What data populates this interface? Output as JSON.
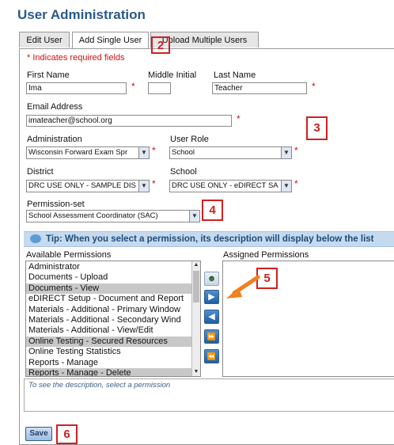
{
  "page_title": "User Administration",
  "tabs": [
    "Edit User",
    "Add Single User",
    "Upload Multiple Users"
  ],
  "required_note": "* Indicates required fields",
  "form": {
    "first_name_label": "First Name",
    "first_name_value": "Ima",
    "middle_initial_label": "Middle Initial",
    "middle_initial_value": "",
    "last_name_label": "Last Name",
    "last_name_value": "Teacher",
    "email_label": "Email Address",
    "email_value": "imateacher@school.org",
    "administration_label": "Administration",
    "administration_value": "Wisconsin Forward Exam Spr",
    "user_role_label": "User Role",
    "user_role_value": "School",
    "district_label": "District",
    "district_value": "DRC USE ONLY - SAMPLE DIS",
    "school_label": "School",
    "school_value": "DRC USE ONLY - eDIRECT SA",
    "permission_set_label": "Permission-set",
    "permission_set_value": "School Assessment Coordinator (SAC)",
    "required_star": "*"
  },
  "tip": "Tip: When you select a permission, its description will display below the list",
  "permissions": {
    "available_label": "Available Permissions",
    "assigned_label": "Assigned Permissions",
    "available_items": [
      {
        "label": "Administrator",
        "selected": false
      },
      {
        "label": "Documents - Upload",
        "selected": false
      },
      {
        "label": "Documents - View",
        "selected": true
      },
      {
        "label": "eDIRECT Setup - Document and Report",
        "selected": false
      },
      {
        "label": "Materials - Additional - Primary Window",
        "selected": false
      },
      {
        "label": "Materials - Additional - Secondary Wind",
        "selected": false
      },
      {
        "label": "Materials - Additional - View/Edit",
        "selected": false
      },
      {
        "label": "Online Testing - Secured Resources",
        "selected": true
      },
      {
        "label": "Online Testing Statistics",
        "selected": false
      },
      {
        "label": "Reports - Manage",
        "selected": false
      },
      {
        "label": "Reports - Manage - Delete",
        "selected": true
      }
    ],
    "description_hint": "To see the description, select a permission"
  },
  "save_label": "Save",
  "callouts": [
    "2",
    "3",
    "4",
    "5",
    "6"
  ],
  "icons": {
    "dropdown": "▼",
    "move_right": "▶",
    "move_left": "◀",
    "move_all_right": "⏩",
    "move_all_left": "⏪",
    "add_users": "add-users-icon"
  },
  "colors": {
    "title": "#2a5a8c",
    "required": "#d01010",
    "callout": "#d02020",
    "tip_bg": "#c5daee",
    "button_blue": "#1f5fa3",
    "arrow_orange": "#f08020"
  }
}
